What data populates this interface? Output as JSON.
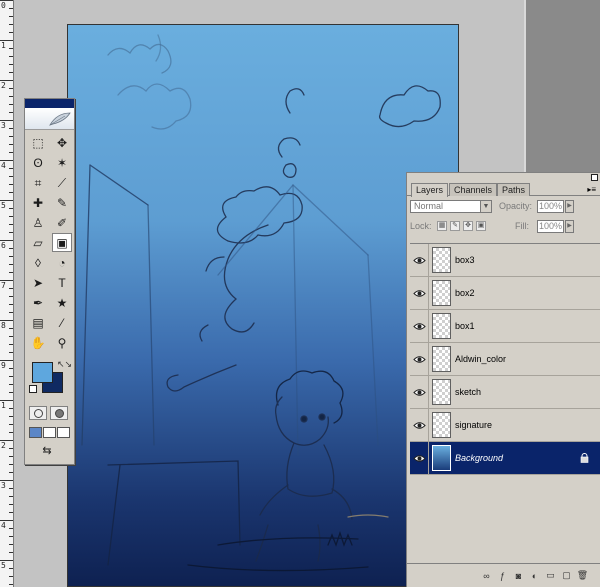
{
  "ruler": {
    "labels": [
      "0",
      "1",
      "2",
      "3",
      "4",
      "5",
      "6",
      "7",
      "8",
      "9",
      "1",
      "2",
      "3",
      "4",
      "5"
    ]
  },
  "colors": {
    "foreground": "#5ea7de",
    "background": "#0f2a62",
    "selection": "#0a246a",
    "panel": "#d4d0c8"
  },
  "toolbox": {
    "tools": [
      {
        "name": "marquee-tool-icon",
        "glyph": "⬚"
      },
      {
        "name": "move-tool-icon",
        "glyph": "✥"
      },
      {
        "name": "lasso-tool-icon",
        "glyph": "ʘ"
      },
      {
        "name": "magic-wand-tool-icon",
        "glyph": "✶"
      },
      {
        "name": "crop-tool-icon",
        "glyph": "⌗"
      },
      {
        "name": "slice-tool-icon",
        "glyph": "⟋"
      },
      {
        "name": "healing-brush-tool-icon",
        "glyph": "✚"
      },
      {
        "name": "brush-tool-icon",
        "glyph": "✎"
      },
      {
        "name": "clone-stamp-tool-icon",
        "glyph": "♙"
      },
      {
        "name": "history-brush-tool-icon",
        "glyph": "✐"
      },
      {
        "name": "eraser-tool-icon",
        "glyph": "▱"
      },
      {
        "name": "gradient-tool-icon",
        "glyph": "▣"
      },
      {
        "name": "blur-tool-icon",
        "glyph": "◊"
      },
      {
        "name": "dodge-tool-icon",
        "glyph": "◔"
      },
      {
        "name": "path-selection-tool-icon",
        "glyph": "➤"
      },
      {
        "name": "type-tool-icon",
        "glyph": "T"
      },
      {
        "name": "pen-tool-icon",
        "glyph": "✒"
      },
      {
        "name": "custom-shape-tool-icon",
        "glyph": "★"
      },
      {
        "name": "notes-tool-icon",
        "glyph": "▤"
      },
      {
        "name": "eyedropper-tool-icon",
        "glyph": "⁄"
      },
      {
        "name": "hand-tool-icon",
        "glyph": "✋"
      },
      {
        "name": "zoom-tool-icon",
        "glyph": "⚲"
      }
    ],
    "active_tool": "gradient-tool-icon"
  },
  "layers_panel": {
    "tabs": [
      "Layers",
      "Channels",
      "Paths"
    ],
    "active_tab": "Layers",
    "blend_mode": "Normal",
    "opacity_label": "Opacity:",
    "opacity_value": "100%",
    "lock_label": "Lock:",
    "fill_label": "Fill:",
    "fill_value": "100%",
    "layers": [
      {
        "name": "box3",
        "visible": true,
        "selected": false,
        "locked": false
      },
      {
        "name": "box2",
        "visible": true,
        "selected": false,
        "locked": false
      },
      {
        "name": "box1",
        "visible": true,
        "selected": false,
        "locked": false
      },
      {
        "name": "Aldwin_color",
        "visible": true,
        "selected": false,
        "locked": false
      },
      {
        "name": "sketch",
        "visible": true,
        "selected": false,
        "locked": false
      },
      {
        "name": "signature",
        "visible": true,
        "selected": false,
        "locked": false
      },
      {
        "name": "Background",
        "visible": true,
        "selected": true,
        "locked": true
      }
    ]
  }
}
